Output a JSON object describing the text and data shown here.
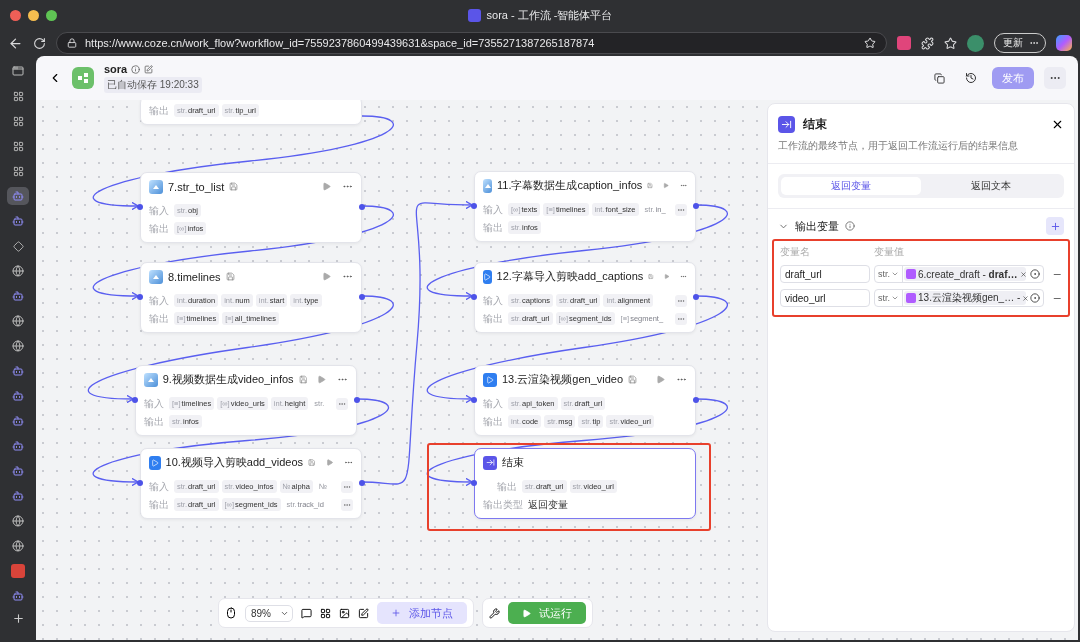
{
  "browser": {
    "tab_title": "sora - 工作流 -智能体平台",
    "url": "https://www.coze.cn/work_flow?workflow_id=7559237860499439631&space_id=7355271387265187874",
    "update_label": "更新"
  },
  "side_tabs": [
    {
      "kind": "page",
      "selected": false
    },
    {
      "kind": "app",
      "selected": false
    },
    {
      "kind": "app",
      "selected": false
    },
    {
      "kind": "app",
      "selected": false
    },
    {
      "kind": "app",
      "selected": false
    },
    {
      "kind": "avatar",
      "selected": true
    },
    {
      "kind": "avatar",
      "selected": false
    },
    {
      "kind": "diamond",
      "selected": false
    },
    {
      "kind": "globe",
      "selected": false
    },
    {
      "kind": "avatar",
      "selected": false
    },
    {
      "kind": "globe",
      "selected": false
    },
    {
      "kind": "globe",
      "selected": false
    },
    {
      "kind": "avatar",
      "selected": false
    },
    {
      "kind": "avatar",
      "selected": false
    },
    {
      "kind": "avatar",
      "selected": false
    },
    {
      "kind": "avatar",
      "selected": false
    },
    {
      "kind": "avatar",
      "selected": false
    },
    {
      "kind": "avatar",
      "selected": false
    },
    {
      "kind": "globe",
      "selected": false
    },
    {
      "kind": "globe",
      "selected": false
    },
    {
      "kind": "red",
      "selected": false
    },
    {
      "kind": "avatar",
      "selected": false
    }
  ],
  "header": {
    "title": "sora",
    "saved": "已自动保存 19:20:33",
    "publish": "发布",
    "publish_disabled": true
  },
  "nodes": [
    {
      "selected": false,
      "outputs_label": "输出",
      "outputs": [
        {
          "type": "str.",
          "name": "draft_url"
        },
        {
          "type": "str.",
          "name": "tip_url"
        }
      ]
    },
    {
      "kind": "code",
      "title": "7.str_to_list",
      "selected": false,
      "inputs_label": "输入",
      "inputs": [
        {
          "type": "str.",
          "name": "obj"
        }
      ],
      "outputs_label": "输出",
      "outputs": [
        {
          "type": "[∞]",
          "name": "infos"
        }
      ]
    },
    {
      "kind": "code",
      "title": "8.timelines",
      "selected": false,
      "inputs_label": "输入",
      "inputs": [
        {
          "type": "int.",
          "name": "duration"
        },
        {
          "type": "int.",
          "name": "num"
        },
        {
          "type": "int.",
          "name": "start"
        },
        {
          "type": "int.",
          "name": "type"
        }
      ],
      "outputs_label": "输出",
      "outputs": [
        {
          "type": "[≡]",
          "name": "timelines"
        },
        {
          "type": "[≡]",
          "name": "all_timelines"
        }
      ]
    },
    {
      "kind": "code",
      "title": "9.视频数据生成video_infos",
      "selected": false,
      "inputs_label": "输入",
      "inputs": [
        {
          "type": "[≡]",
          "name": "timelines"
        },
        {
          "type": "[∞]",
          "name": "video_urls"
        },
        {
          "type": "int.",
          "name": "height"
        },
        {
          "type": "str.",
          "faded": true
        }
      ],
      "inputs_more": true,
      "outputs_label": "输出",
      "outputs": [
        {
          "type": "str.",
          "name": "infos"
        }
      ]
    },
    {
      "kind": "plugin",
      "title": "10.视频导入剪映add_videos",
      "selected": false,
      "inputs_label": "输入",
      "inputs": [
        {
          "type": "str.",
          "name": "draft_url"
        },
        {
          "type": "str.",
          "name": "video_infos"
        },
        {
          "type": "№",
          "name": "alpha"
        },
        {
          "type": "№",
          "faded": true
        }
      ],
      "inputs_more": true,
      "outputs_label": "输出",
      "outputs": [
        {
          "type": "str.",
          "name": "draft_url"
        },
        {
          "type": "[∞]",
          "name": "segment_ids"
        },
        {
          "type": "str.",
          "name": "track_id",
          "faded": true
        }
      ],
      "outputs_more": true
    },
    {
      "kind": "code",
      "title": "11.字幕数据生成caption_infos",
      "selected": false,
      "inputs_label": "输入",
      "inputs": [
        {
          "type": "[∞]",
          "name": "texts"
        },
        {
          "type": "[≡]",
          "name": "timelines"
        },
        {
          "type": "int.",
          "name": "font_size"
        },
        {
          "type": "str.",
          "name": "in_",
          "faded": true
        }
      ],
      "inputs_more": true,
      "outputs_label": "输出",
      "outputs": [
        {
          "type": "str.",
          "name": "infos"
        }
      ]
    },
    {
      "kind": "plugin",
      "title": "12.字幕导入剪映add_captions",
      "selected": false,
      "inputs_label": "输入",
      "inputs": [
        {
          "type": "str.",
          "name": "captions"
        },
        {
          "type": "str.",
          "name": "draft_url"
        },
        {
          "type": "int.",
          "name": "alignment"
        }
      ],
      "inputs_more": true,
      "outputs_label": "输出",
      "outputs": [
        {
          "type": "str.",
          "name": "draft_url"
        },
        {
          "type": "[∞]",
          "name": "segment_ids"
        },
        {
          "type": "[≡]",
          "name": "segment_",
          "faded": true
        }
      ],
      "outputs_more": true
    },
    {
      "kind": "plugin",
      "title": "13.云渲染视频gen_video",
      "selected": false,
      "inputs_label": "输入",
      "inputs": [
        {
          "type": "str.",
          "name": "api_token"
        },
        {
          "type": "str.",
          "name": "draft_url"
        }
      ],
      "outputs_label": "输出",
      "outputs": [
        {
          "type": "int.",
          "name": "code"
        },
        {
          "type": "str.",
          "name": "msg"
        },
        {
          "type": "str.",
          "name": "tip"
        },
        {
          "type": "str.",
          "name": "video_url"
        }
      ]
    },
    {
      "kind": "end",
      "title": "结束",
      "selected": true,
      "highlighted": true,
      "outputs_label": "输出",
      "outputs": [
        {
          "type": "str.",
          "name": "draft_url"
        },
        {
          "type": "str.",
          "name": "video_url"
        }
      ],
      "extra_label": "输出类型",
      "extra_value": "返回变量"
    }
  ],
  "panel": {
    "title": "结束",
    "description": "工作流的最终节点，用于返回工作流运行后的结果信息",
    "tabs": [
      {
        "label": "返回变量",
        "selected": true
      },
      {
        "label": "返回文本",
        "selected": false
      }
    ],
    "section": "输出变量",
    "expanded": true,
    "highlighted": true,
    "columns": [
      "变量名",
      "变量值"
    ],
    "variables": [
      {
        "name": "draft_url",
        "type": "str.",
        "ref": "6.create_draft - **draf…**"
      },
      {
        "name": "video_url",
        "type": "str.",
        "ref": "13.云渲染视频gen_… -"
      }
    ]
  },
  "toolbar": {
    "zoom": "89%",
    "add_node": "添加节点",
    "run": "试运行"
  }
}
